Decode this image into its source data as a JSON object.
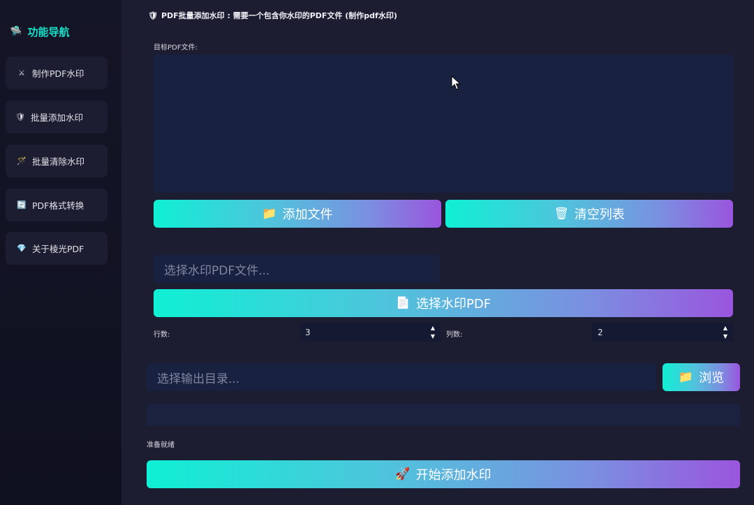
{
  "sidebar": {
    "title": "功能导航",
    "title_icon": "ufo-icon",
    "items": [
      {
        "label": "制作PDF水印",
        "icon": "crossed-swords-icon",
        "glyph": "⚔"
      },
      {
        "label": "批量添加水印",
        "icon": "shield-icon",
        "glyph": "🛡"
      },
      {
        "label": "批量清除水印",
        "icon": "magic-wand-icon",
        "glyph": "🪄"
      },
      {
        "label": "PDF格式转换",
        "icon": "refresh-icon",
        "glyph": "🔄"
      },
      {
        "label": "关于棱光PDF",
        "icon": "gem-icon",
        "glyph": "💎"
      }
    ]
  },
  "header": {
    "icon": "shield-icon",
    "text": "PDF批量添加水印 : 需要一个包含你水印的PDF文件 (制作pdf水印)"
  },
  "target": {
    "label": "目标PDF文件:"
  },
  "buttons": {
    "add_files": "添加文件",
    "clear_list": "清空列表",
    "select_watermark": "选择水印PDF",
    "browse": "浏览",
    "start": "开始添加水印"
  },
  "watermark_input": {
    "placeholder": "选择水印PDF文件..."
  },
  "grid": {
    "rows_label": "行数:",
    "rows_value": "3",
    "cols_label": "列数:",
    "cols_value": "2"
  },
  "output_input": {
    "placeholder": "选择输出目录..."
  },
  "status": {
    "text": "准备就绪"
  },
  "colors": {
    "accent": "#18e0c8",
    "gradient_start": "#0ff0d4",
    "gradient_end": "#9a55de",
    "background": "#1c1d31",
    "input_bg": "#182140"
  }
}
